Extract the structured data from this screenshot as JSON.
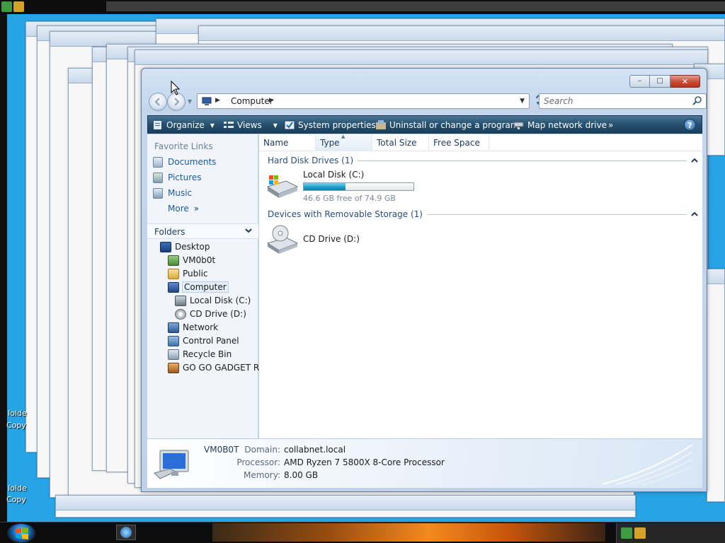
{
  "window": {
    "title_path": [
      "Computer"
    ],
    "search_placeholder": "Search"
  },
  "caption_buttons": {
    "minimize": "–",
    "maximize": "□",
    "close": "✕"
  },
  "toolbar": {
    "organize": "Organize",
    "views": "Views",
    "system_properties": "System properties",
    "uninstall": "Uninstall or change a program",
    "map_drive": "Map network drive",
    "more": "»",
    "help": "?"
  },
  "favorites": {
    "title": "Favorite Links",
    "items": [
      "Documents",
      "Pictures",
      "Music"
    ],
    "more": "More",
    "more_glyph": "»"
  },
  "folders": {
    "title": "Folders",
    "tree": [
      {
        "label": "Desktop",
        "icon": "desktop-icon"
      },
      {
        "label": "VM0b0t",
        "icon": "user-folder-icon"
      },
      {
        "label": "Public",
        "icon": "folder-icon"
      },
      {
        "label": "Computer",
        "icon": "computer-icon",
        "selected": true
      },
      {
        "label": "Local Disk (C:)",
        "icon": "hard-disk-icon"
      },
      {
        "label": "CD Drive (D:)",
        "icon": "cd-drive-icon"
      },
      {
        "label": "Network",
        "icon": "network-icon"
      },
      {
        "label": "Control Panel",
        "icon": "control-panel-icon"
      },
      {
        "label": "Recycle Bin",
        "icon": "recycle-bin-icon"
      },
      {
        "label": "GO GO GADGET RA",
        "icon": "gadget-folder-icon"
      }
    ]
  },
  "columns": [
    "Name",
    "Type",
    "Total Size",
    "Free Space"
  ],
  "groups": {
    "hard_disks": {
      "title": "Hard Disk Drives (1)",
      "drives": [
        {
          "name": "Local Disk (C:)",
          "free_text": "46.6 GB free of 74.9 GB",
          "used_fraction": 0.378
        }
      ]
    },
    "removable": {
      "title": "Devices with Removable Storage (1)",
      "drives": [
        {
          "name": "CD Drive (D:)"
        }
      ]
    }
  },
  "details": {
    "computer_name": "VM0B0T",
    "domain_label": "Domain:",
    "domain": "collabnet.local",
    "processor_label": "Processor:",
    "processor": "AMD Ryzen 7 5800X 8-Core Processor",
    "memory_label": "Memory:",
    "memory": "8.00 GB"
  },
  "desktop_labels": [
    "Iolde",
    "Copy",
    "Iolde",
    "Copy"
  ],
  "colors": {
    "desktop": "#27a4e6",
    "command_bar": "#26506f",
    "accent_link": "#1a5aa0",
    "capacity_fill": "#1c9ec9"
  }
}
